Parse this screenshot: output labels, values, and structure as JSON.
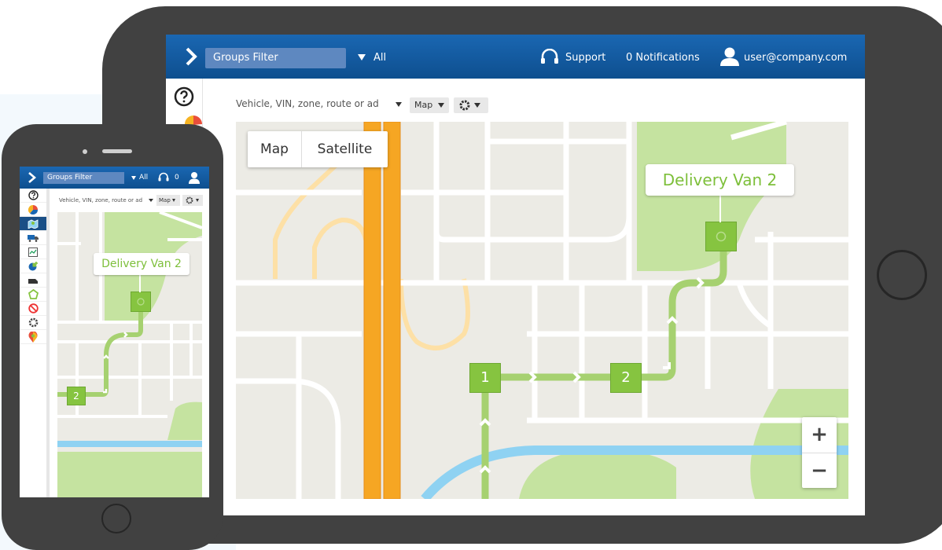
{
  "header": {
    "groups_filter": "Groups Filter",
    "all": "All",
    "support": "Support",
    "notifications": "0 Notifications",
    "user": "user@company.com",
    "mobile_notifications_count": "0"
  },
  "toolbar": {
    "search_placeholder": "Vehicle, VIN, zone, route or ad",
    "map_dropdown": "Map"
  },
  "map": {
    "type_toggle": [
      "Map",
      "Satellite"
    ],
    "vehicle_label": "Delivery Van 2",
    "stops": [
      "1",
      "2"
    ],
    "zoom_in": "+",
    "zoom_out": "−"
  },
  "colors": {
    "topbar": "#1a67b2",
    "route": "#a6d170",
    "stop": "#86c440",
    "highway": "#f6a623",
    "river": "#8fd2f2",
    "park": "#c5e3a0",
    "device": "#414141"
  },
  "sidebar_icons": [
    "help-icon",
    "pie-chart-icon",
    "map-icon",
    "truck-icon",
    "activity-chart-icon",
    "pie-chart-plus-icon",
    "vehicle-icon",
    "zone-icon",
    "no-entry-icon",
    "gear-icon",
    "map-pin-icon"
  ]
}
